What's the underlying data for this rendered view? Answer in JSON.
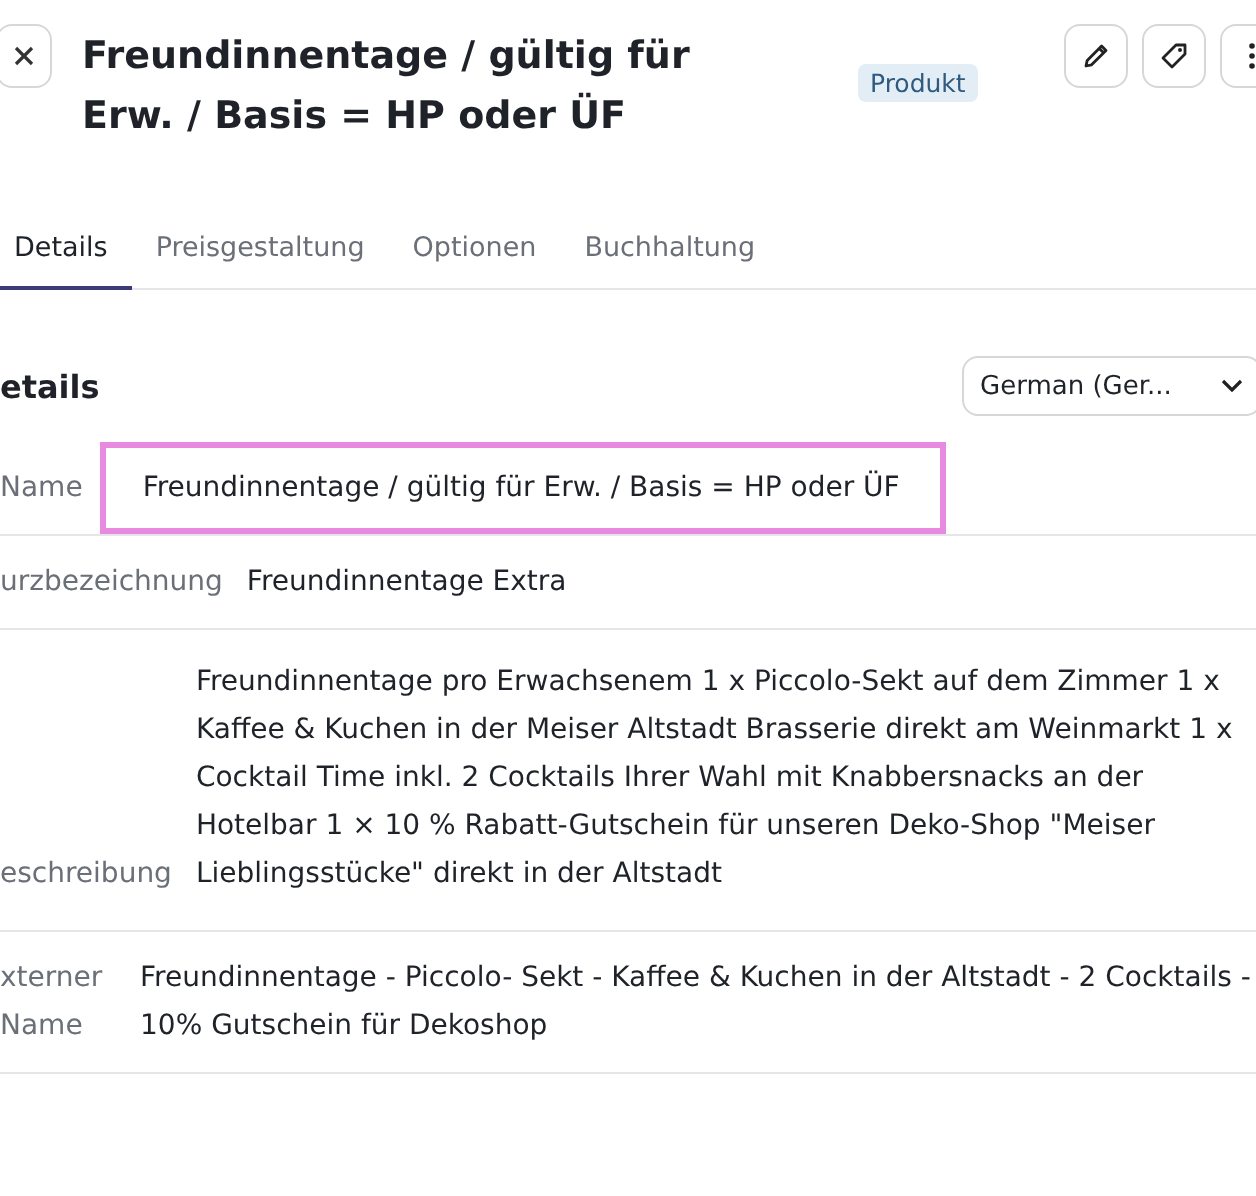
{
  "header": {
    "title": "Freundinnentage / gültig für Erw. / Basis = HP oder ÜF",
    "badge": "Produkt"
  },
  "tabs": [
    {
      "label": "Details",
      "selected": true
    },
    {
      "label": "Preisgestaltung",
      "selected": false
    },
    {
      "label": "Optionen",
      "selected": false
    },
    {
      "label": "Buchhaltung",
      "selected": false
    }
  ],
  "section": {
    "title": "etails",
    "language": "German (Ger..."
  },
  "fields": [
    {
      "label": "Name",
      "value": "Freundinnentage / gültig für Erw. / Basis = HP oder ÜF",
      "highlighted": true
    },
    {
      "label": "urzbezeichnung",
      "value": "Freundinnentage Extra",
      "highlighted": false
    },
    {
      "label": "eschreibung",
      "value": "Freundinnentage pro Erwachsenem 1 x Piccolo-Sekt auf dem Zimmer 1 x Kaffee & Kuchen in der Meiser Altstadt Brasserie direkt am Weinmarkt 1 x Cocktail Time inkl. 2 Cocktails Ihrer Wahl mit Knabbersnacks an der Hotelbar 1 × 10 % Rabatt-Gutschein für unseren Deko-Shop \"Meiser Lieblingsstücke\" direkt in der Altstadt",
      "highlighted": false
    },
    {
      "label": "xterner Name",
      "value": "Freundinnentage - Piccolo- Sekt - Kaffee & Kuchen in der Altstadt - 2 Cocktails - 10% Gutschein für Dekoshop",
      "highlighted": false
    }
  ]
}
